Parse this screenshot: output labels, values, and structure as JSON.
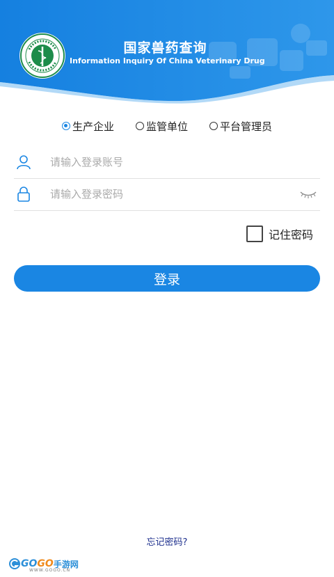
{
  "header": {
    "title_cn": "国家兽药查询",
    "title_en": "Information Inquiry Of China Veterinary Drug",
    "logo_icon": "vet-emblem-icon",
    "bg_color": "#1a86e3"
  },
  "roles": {
    "selected": "生产企业",
    "options": [
      "生产企业",
      "监管单位",
      "平台管理员"
    ]
  },
  "account": {
    "placeholder": "请输入登录账号",
    "value": "",
    "icon": "user-icon"
  },
  "password": {
    "placeholder": "请输入登录密码",
    "value": "",
    "icon": "lock-icon",
    "toggle_icon": "eye-closed-icon"
  },
  "remember": {
    "label": "记住密码",
    "checked": false
  },
  "login": {
    "label": "登录"
  },
  "forgot": {
    "label": "忘记密码?"
  },
  "watermark": {
    "brand_a": "GO",
    "brand_b": "GO",
    "brand_c": "手游网",
    "domain": "WWW.GOGO.CN"
  }
}
